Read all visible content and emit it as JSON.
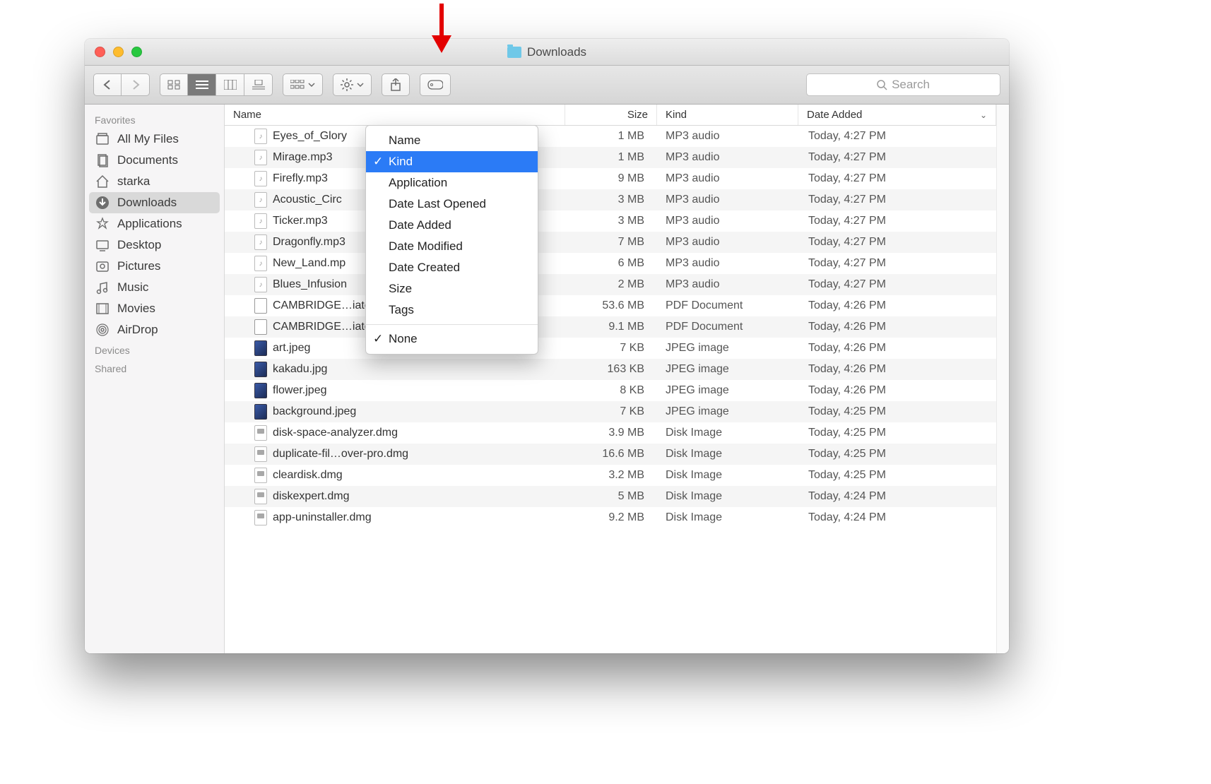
{
  "window": {
    "title": "Downloads"
  },
  "toolbar": {
    "search_placeholder": "Search"
  },
  "sidebar": {
    "sections": [
      {
        "label": "Favorites",
        "items": [
          {
            "label": "All My Files",
            "icon": "all-files"
          },
          {
            "label": "Documents",
            "icon": "documents"
          },
          {
            "label": "starka",
            "icon": "home"
          },
          {
            "label": "Downloads",
            "icon": "downloads",
            "selected": true
          },
          {
            "label": "Applications",
            "icon": "applications"
          },
          {
            "label": "Desktop",
            "icon": "desktop"
          },
          {
            "label": "Pictures",
            "icon": "pictures"
          },
          {
            "label": "Music",
            "icon": "music"
          },
          {
            "label": "Movies",
            "icon": "movies"
          },
          {
            "label": "AirDrop",
            "icon": "airdrop"
          }
        ]
      },
      {
        "label": "Devices",
        "items": []
      },
      {
        "label": "Shared",
        "items": []
      }
    ]
  },
  "columns": {
    "name": "Name",
    "size": "Size",
    "kind": "Kind",
    "date": "Date Added"
  },
  "menu": {
    "items": [
      "Name",
      "Kind",
      "Application",
      "Date Last Opened",
      "Date Added",
      "Date Modified",
      "Date Created",
      "Size",
      "Tags"
    ],
    "selected": "Kind",
    "footer": "None",
    "footer_checked": true
  },
  "files": [
    {
      "name": "Eyes_of_Glory",
      "size": "1 MB",
      "kind": "MP3 audio",
      "date": "Today, 4:27 PM",
      "ico": "mp3"
    },
    {
      "name": "Mirage.mp3",
      "size": "1 MB",
      "kind": "MP3 audio",
      "date": "Today, 4:27 PM",
      "ico": "mp3"
    },
    {
      "name": "Firefly.mp3",
      "size": "9 MB",
      "kind": "MP3 audio",
      "date": "Today, 4:27 PM",
      "ico": "mp3"
    },
    {
      "name": "Acoustic_Circ",
      "size": "3 MB",
      "kind": "MP3 audio",
      "date": "Today, 4:27 PM",
      "ico": "mp3"
    },
    {
      "name": "Ticker.mp3",
      "size": "3 MB",
      "kind": "MP3 audio",
      "date": "Today, 4:27 PM",
      "ico": "mp3"
    },
    {
      "name": "Dragonfly.mp3",
      "size": "7 MB",
      "kind": "MP3 audio",
      "date": "Today, 4:27 PM",
      "ico": "mp3"
    },
    {
      "name": "New_Land.mp",
      "size": "6 MB",
      "kind": "MP3 audio",
      "date": "Today, 4:27 PM",
      "ico": "mp3"
    },
    {
      "name": "Blues_Infusion",
      "size": "2 MB",
      "kind": "MP3 audio",
      "date": "Today, 4:27 PM",
      "ico": "mp3"
    },
    {
      "name": "CAMBRIDGE…iate_Stud.pdf",
      "size": "53.6 MB",
      "kind": "PDF Document",
      "date": "Today, 4:26 PM",
      "ico": "pdf"
    },
    {
      "name": "CAMBRIDGE…iate_Work.pdf",
      "size": "9.1 MB",
      "kind": "PDF Document",
      "date": "Today, 4:26 PM",
      "ico": "pdf"
    },
    {
      "name": "art.jpeg",
      "size": "7 KB",
      "kind": "JPEG image",
      "date": "Today, 4:26 PM",
      "ico": "img"
    },
    {
      "name": "kakadu.jpg",
      "size": "163 KB",
      "kind": "JPEG image",
      "date": "Today, 4:26 PM",
      "ico": "img"
    },
    {
      "name": "flower.jpeg",
      "size": "8 KB",
      "kind": "JPEG image",
      "date": "Today, 4:26 PM",
      "ico": "img"
    },
    {
      "name": "background.jpeg",
      "size": "7 KB",
      "kind": "JPEG image",
      "date": "Today, 4:25 PM",
      "ico": "img"
    },
    {
      "name": "disk-space-analyzer.dmg",
      "size": "3.9 MB",
      "kind": "Disk Image",
      "date": "Today, 4:25 PM",
      "ico": "dmg"
    },
    {
      "name": "duplicate-fil…over-pro.dmg",
      "size": "16.6 MB",
      "kind": "Disk Image",
      "date": "Today, 4:25 PM",
      "ico": "dmg"
    },
    {
      "name": "cleardisk.dmg",
      "size": "3.2 MB",
      "kind": "Disk Image",
      "date": "Today, 4:25 PM",
      "ico": "dmg"
    },
    {
      "name": "diskexpert.dmg",
      "size": "5 MB",
      "kind": "Disk Image",
      "date": "Today, 4:24 PM",
      "ico": "dmg"
    },
    {
      "name": "app-uninstaller.dmg",
      "size": "9.2 MB",
      "kind": "Disk Image",
      "date": "Today, 4:24 PM",
      "ico": "dmg"
    }
  ]
}
